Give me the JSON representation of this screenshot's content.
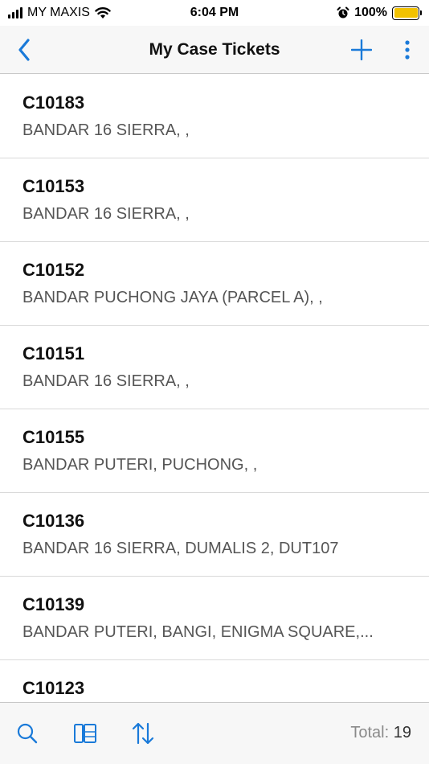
{
  "status_bar": {
    "carrier": "MY MAXIS",
    "time": "6:04 PM",
    "battery": "100%",
    "battery_level": 1.0
  },
  "nav": {
    "title": "My Case Tickets",
    "back_icon": "chevron-left-icon",
    "add_icon": "plus-icon",
    "more_icon": "more-vertical-icon"
  },
  "tickets": [
    {
      "id": "C10183",
      "address": "BANDAR 16 SIERRA, ,"
    },
    {
      "id": "C10153",
      "address": "BANDAR 16 SIERRA, ,"
    },
    {
      "id": "C10152",
      "address": "BANDAR PUCHONG JAYA (PARCEL A), ,"
    },
    {
      "id": "C10151",
      "address": "BANDAR 16 SIERRA, ,"
    },
    {
      "id": "C10155",
      "address": "BANDAR PUTERI, PUCHONG, ,"
    },
    {
      "id": "C10136",
      "address": "BANDAR 16 SIERRA, DUMALIS 2, DUT107"
    },
    {
      "id": "C10139",
      "address": "BANDAR PUTERI, BANGI, ENIGMA SQUARE,..."
    },
    {
      "id": "C10123",
      "address": ""
    }
  ],
  "toolbar": {
    "search_icon": "search-icon",
    "layout_icon": "split-view-icon",
    "sort_icon": "sort-arrows-icon",
    "total_label": "Total:",
    "total_count": "19"
  },
  "colors": {
    "accent": "#1a7ad9",
    "battery_fill": "#f2c200",
    "bar_background": "#f7f7f7",
    "divider": "#d9d9d9"
  }
}
